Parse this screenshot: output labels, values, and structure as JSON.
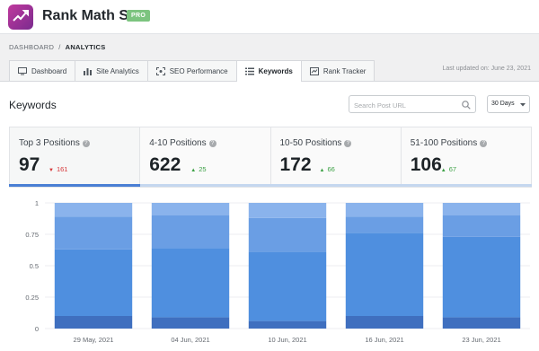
{
  "app": {
    "title": "Rank Math SEO",
    "badge": "PRO"
  },
  "breadcrumb": {
    "parent": "DASHBOARD",
    "separator": "/",
    "current": "ANALYTICS"
  },
  "tabs": [
    {
      "label": "Dashboard",
      "icon": "monitor-icon",
      "active": false
    },
    {
      "label": "Site Analytics",
      "icon": "bar-chart-icon",
      "active": false
    },
    {
      "label": "SEO Performance",
      "icon": "seo-scan-icon",
      "active": false
    },
    {
      "label": "Keywords",
      "icon": "list-icon",
      "active": true
    },
    {
      "label": "Rank Tracker",
      "icon": "tracker-icon",
      "active": false
    }
  ],
  "last_updated": "Last updated on: June 23, 2021",
  "section": {
    "title": "Keywords"
  },
  "search": {
    "placeholder": "Search Post URL",
    "value": ""
  },
  "range": {
    "selected": "30 Days"
  },
  "stats": [
    {
      "label": "Top 3 Positions",
      "value": "97",
      "delta": "161",
      "direction": "down",
      "active": true
    },
    {
      "label": "4-10 Positions",
      "value": "622",
      "delta": "25",
      "direction": "up",
      "active": false
    },
    {
      "label": "10-50 Positions",
      "value": "172",
      "delta": "66",
      "direction": "up",
      "active": false
    },
    {
      "label": "51-100 Positions",
      "value": "106",
      "delta": "67",
      "direction": "up",
      "active": false
    }
  ],
  "chart_data": {
    "type": "bar",
    "stacked": true,
    "categories": [
      "29 May, 2021",
      "04 Jun, 2021",
      "10 Jun, 2021",
      "16 Jun, 2021",
      "23 Jun, 2021"
    ],
    "yticks": [
      "0",
      "0.25",
      "0.5",
      "0.75",
      "1"
    ],
    "ylim": [
      0,
      1
    ],
    "grid": true,
    "series": [
      {
        "color": "#3f6fbf",
        "values": [
          0.1,
          0.09,
          0.06,
          0.1,
          0.09
        ]
      },
      {
        "color": "#4f8fdf",
        "values": [
          0.53,
          0.55,
          0.55,
          0.66,
          0.64
        ]
      },
      {
        "color": "#6a9ee4",
        "values": [
          0.26,
          0.26,
          0.27,
          0.13,
          0.17
        ]
      },
      {
        "color": "#8ab3ec",
        "values": [
          0.11,
          0.1,
          0.12,
          0.11,
          0.1
        ]
      }
    ]
  }
}
